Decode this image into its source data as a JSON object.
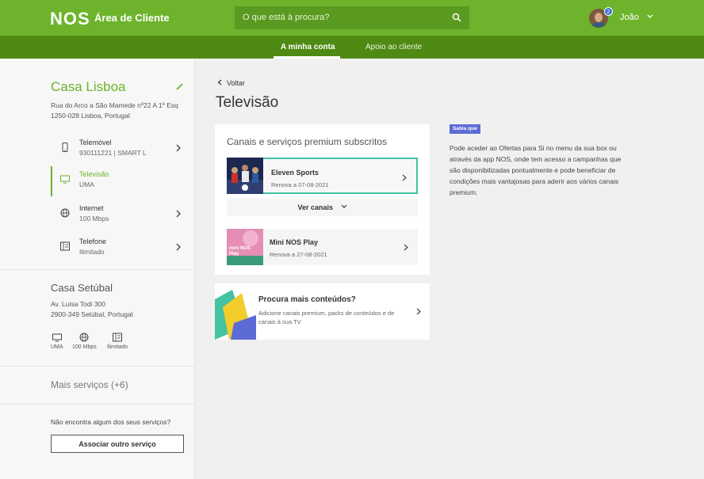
{
  "header": {
    "logo": "NOS",
    "portal_title": "Área de Cliente",
    "search_placeholder": "O que está à procura?",
    "notification_count": "2",
    "user_name": "João"
  },
  "subnav": {
    "active_tab": "A minha conta",
    "support_tab": "Apoio ao cliente"
  },
  "sidebar": {
    "home_title": "Casa Lisboa",
    "home_address": "Rua do Arco a São Mamede nº22 A 1º Esq 1250-028 Lisboa, Portugal",
    "services": [
      {
        "name": "Telemóvel",
        "sub": "930111221 | SMART L",
        "icon": "mobile-phone-icon"
      },
      {
        "name": "Televisão",
        "sub": "UMA",
        "icon": "tv-icon"
      },
      {
        "name": "Internet",
        "sub": "100 Mbps",
        "icon": "globe-icon"
      },
      {
        "name": "Telefone",
        "sub": "Ilimitado",
        "icon": "landline-phone-icon"
      }
    ],
    "home2_title": "Casa Setúbal",
    "home2_address_line1": "Av. Luísa Todi 300",
    "home2_address_line2": "2900-349 Setúbal, Portugal",
    "home2_services": [
      "UMA",
      "100 Mbps",
      "Ilimitado"
    ],
    "more_services": "Mais serviços (+6)",
    "question": "Não encontra algum dos seus serviços?",
    "associate_button": "Associar outro serviço"
  },
  "main": {
    "back_label": "Voltar",
    "page_title": "Televisão",
    "card_title": "Canais e serviços premium subscritos",
    "items": [
      {
        "name": "Eleven Sports",
        "renew": "Renova a 07-08-2021"
      },
      {
        "name": "Mini NOS Play",
        "renew": "Renova a 27-08-2021"
      }
    ],
    "thumb2_text": "mini NOS Play",
    "see_channels": "Ver canais",
    "promo_title": "Procura mais conteúdos?",
    "promo_desc": "Adicione canais premium, packs de conteúdos e de canais à sua TV"
  },
  "tip": {
    "tag": "Sabia que",
    "text": "Pode aceder ao Ofertas para Si no menu da sua box ou através da app NOS, onde tem acesso a campanhas que são disponibilizadas pontualmente e pode beneficiar de condições mais vantajosas para aderir aos vários canais premium."
  },
  "colors": {
    "brand_green": "#6db32c",
    "dark_green": "#4f8a14",
    "selected_border": "#44c2a2",
    "tag_blue": "#5c6bd6"
  }
}
